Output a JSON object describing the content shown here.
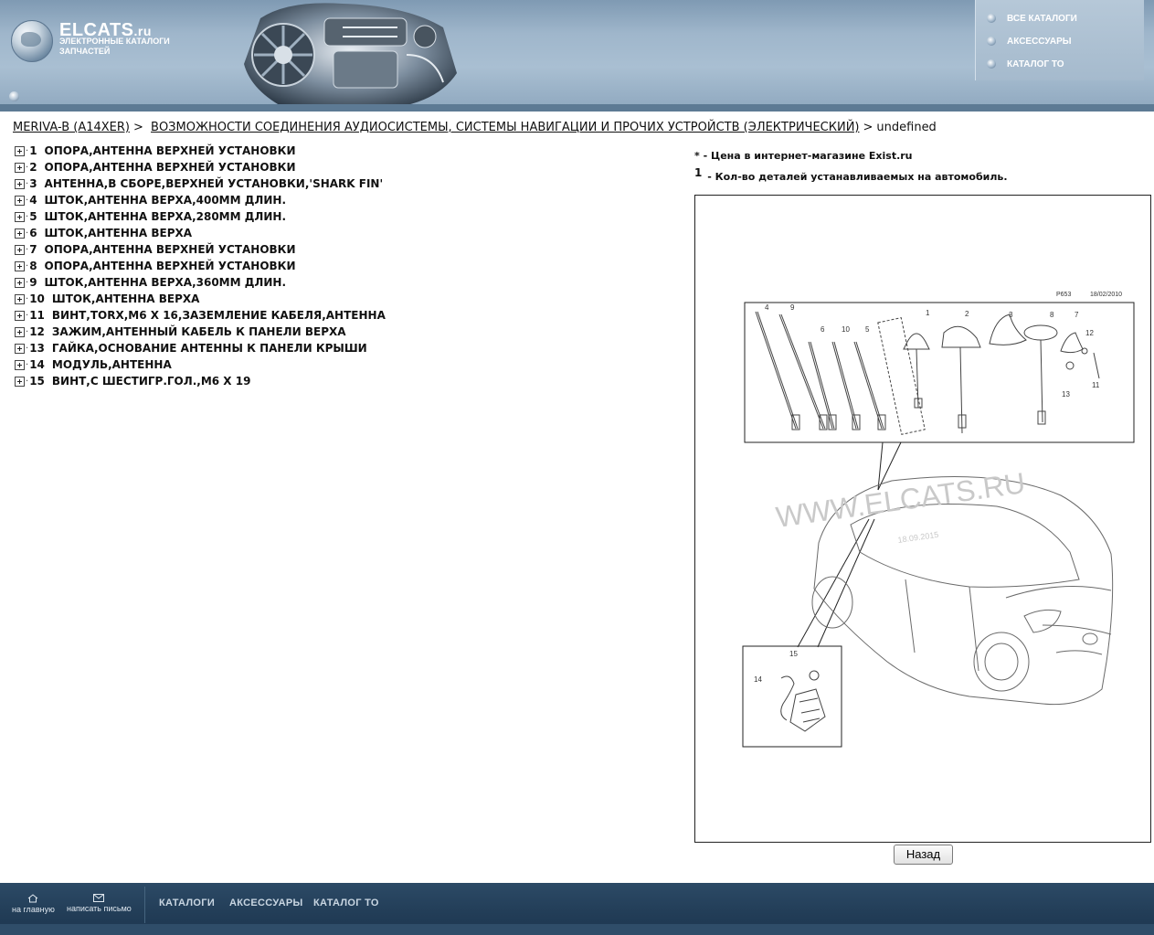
{
  "logo": {
    "title": "ELCATS",
    "suffix": ".ru",
    "subtitle": "ЭЛЕКТРОННЫЕ КАТАЛОГИ ЗАПЧАСТЕЙ"
  },
  "top_menu": [
    {
      "label": "ВСЕ КАТАЛОГИ"
    },
    {
      "label": "АКСЕССУАРЫ"
    },
    {
      "label": "КАТАЛОГ ТО"
    }
  ],
  "breadcrumb": {
    "model": "MERIVA-B (A14XER)",
    "group": "ВОЗМОЖНОСТИ СОЕДИНЕНИЯ АУДИОСИСТЕМЫ, СИСТЕМЫ НАВИГАЦИИ И ПРОЧИХ УСТРОЙСТВ (ЭЛЕКТРИЧЕСКИЙ)",
    "current": "undefined",
    "separator": ">"
  },
  "parts": [
    {
      "num": "1",
      "name": "ОПОРА,АНТЕННА ВЕРХНЕЙ УСТАНОВКИ"
    },
    {
      "num": "2",
      "name": "ОПОРА,АНТЕННА ВЕРХНЕЙ УСТАНОВКИ"
    },
    {
      "num": "3",
      "name": "АНТЕННА,В СБОРЕ,ВЕРХНЕЙ УСТАНОВКИ,'SHARK FIN'"
    },
    {
      "num": "4",
      "name": "ШТОК,АНТЕННА ВЕРХА,400ММ ДЛИН."
    },
    {
      "num": "5",
      "name": "ШТОК,АНТЕННА ВЕРХА,280ММ ДЛИН."
    },
    {
      "num": "6",
      "name": "ШТОК,АНТЕННА ВЕРХА"
    },
    {
      "num": "7",
      "name": "ОПОРА,АНТЕННА ВЕРХНЕЙ УСТАНОВКИ"
    },
    {
      "num": "8",
      "name": "ОПОРА,АНТЕННА ВЕРХНЕЙ УСТАНОВКИ"
    },
    {
      "num": "9",
      "name": "ШТОК,АНТЕННА ВЕРХА,360ММ ДЛИН."
    },
    {
      "num": "10",
      "name": "ШТОК,АНТЕННА ВЕРХА"
    },
    {
      "num": "11",
      "name": "ВИНТ,TORX,М6 Х 16,ЗАЗЕМЛЕНИЕ КАБЕЛЯ,АНТЕННА"
    },
    {
      "num": "12",
      "name": "ЗАЖИМ,АНТЕННЫЙ КАБЕЛЬ К ПАНЕЛИ ВЕРХА"
    },
    {
      "num": "13",
      "name": "ГАЙКА,ОСНОВАНИЕ АНТЕННЫ К ПАНЕЛИ КРЫШИ"
    },
    {
      "num": "14",
      "name": "МОДУЛЬ,АНТЕННА"
    },
    {
      "num": "15",
      "name": "ВИНТ,С ШЕСТИГР.ГОЛ.,М6 Х 19"
    }
  ],
  "notes": {
    "price_mark": "*",
    "price_text": " - Цена в интернет-магазине Exist.ru",
    "qty_mark": "1",
    "qty_text": " - Кол-во деталей устанавливаемых на автомобиль."
  },
  "diagram": {
    "code": "P653",
    "date": "18/02/2010",
    "watermark": "WWW.ELCATS.RU",
    "watermark_date": "18.09.2015",
    "callouts": [
      "4",
      "9",
      "6",
      "10",
      "5",
      "1",
      "2",
      "3",
      "8",
      "7",
      "12",
      "13",
      "11",
      "15",
      "14"
    ]
  },
  "back_button": "Назад",
  "footer": {
    "home": "на главную",
    "mail": "написать письмо",
    "nav": [
      "КАТАЛОГИ",
      "АКСЕССУАРЫ",
      "КАТАЛОГ ТО"
    ]
  }
}
